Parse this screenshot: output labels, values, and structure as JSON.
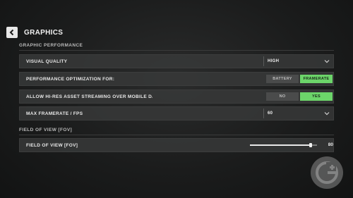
{
  "header": {
    "title": "GRAPHICS",
    "back_icon": "chevron-left-icon"
  },
  "sections": {
    "graphic_performance": "GRAPHIC PERFORMANCE",
    "field_of_view": "FIELD OF VIEW [FOV]"
  },
  "settings": {
    "visual_quality": {
      "label": "VISUAL QUALITY",
      "value": "HIGH"
    },
    "performance_optimization": {
      "label": "PERFORMANCE OPTIMIZATION FOR:",
      "options": [
        "BATTERY",
        "FRAMERATE"
      ],
      "selected": "FRAMERATE"
    },
    "hi_res_streaming": {
      "label": "ALLOW HI-RES ASSET STREAMING OVER MOBILE DATA PLAN",
      "options": [
        "NO",
        "YES"
      ],
      "selected": "YES"
    },
    "max_framerate": {
      "label": "MAX FRAMERATE / FPS",
      "value": "60"
    },
    "fov": {
      "label": "FIELD OF VIEW [FOV]",
      "value": "80",
      "fill_fraction": 0.9
    }
  },
  "colors": {
    "accent_green": "#6cd56a",
    "row_bg": "#373838"
  }
}
